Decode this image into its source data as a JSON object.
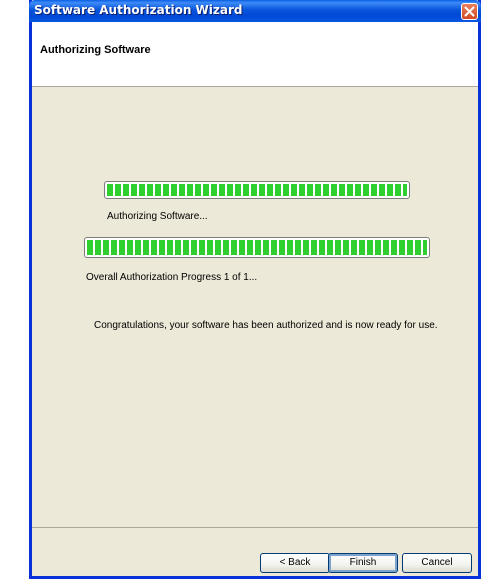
{
  "window": {
    "title": "Software Authorization Wizard",
    "close_icon": "close-icon"
  },
  "header": {
    "title": "Authorizing Software"
  },
  "progress": {
    "step": {
      "label": "Authorizing Software...",
      "fraction": 1.0
    },
    "overall": {
      "label": "Overall Authorization Progress 1 of 1...",
      "fraction": 1.0
    }
  },
  "message": "Congratulations, your software has been authorized and is now ready for use.",
  "buttons": {
    "back": "< Back",
    "finish": "Finish",
    "cancel": "Cancel"
  },
  "colors": {
    "titlebar": "#0855dd",
    "progress_fill": "#2fcf2f",
    "dialog_bg": "#ece9d8"
  }
}
